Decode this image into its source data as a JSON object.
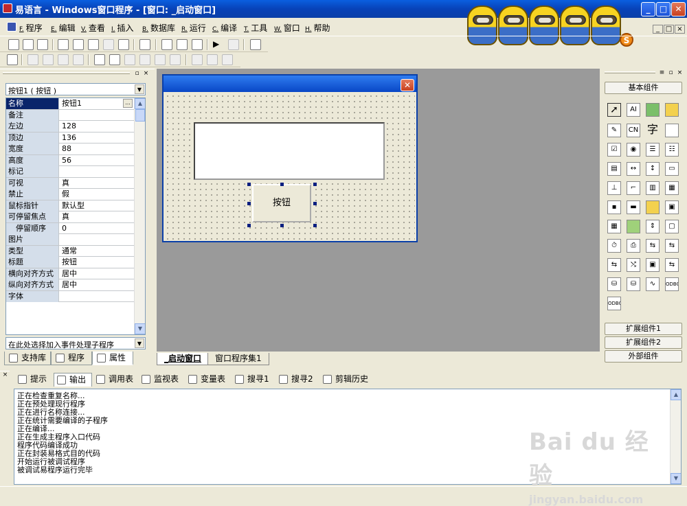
{
  "window": {
    "title": "易语言 - Windows窗口程序 - [窗口: _启动窗口]",
    "min_label": "_",
    "max_label": "□",
    "close_label": "✕"
  },
  "menu": [
    {
      "key": "F.",
      "label": "程序"
    },
    {
      "key": "E.",
      "label": "编辑"
    },
    {
      "key": "V.",
      "label": "查看"
    },
    {
      "key": "I.",
      "label": "插入"
    },
    {
      "key": "B.",
      "label": "数据库"
    },
    {
      "key": "R.",
      "label": "运行"
    },
    {
      "key": "C.",
      "label": "编译"
    },
    {
      "key": "T.",
      "label": "工具"
    },
    {
      "key": "W.",
      "label": "窗口"
    },
    {
      "key": "H.",
      "label": "帮助"
    }
  ],
  "mdi_controls": {
    "min": "_",
    "restore": "□",
    "close": "×"
  },
  "branding": {
    "coin": "S"
  },
  "property_panel": {
    "object_combo": "按钮1 ( 按钮 )",
    "properties": [
      {
        "name": "名称",
        "value": "按钮1"
      },
      {
        "name": "备注",
        "value": ""
      },
      {
        "name": "左边",
        "value": "128"
      },
      {
        "name": "顶边",
        "value": "136"
      },
      {
        "name": "宽度",
        "value": "88"
      },
      {
        "name": "高度",
        "value": "56"
      },
      {
        "name": "标记",
        "value": ""
      },
      {
        "name": "可视",
        "value": "真"
      },
      {
        "name": "禁止",
        "value": "假"
      },
      {
        "name": "鼠标指针",
        "value": "默认型"
      },
      {
        "name": "可停留焦点",
        "value": "真"
      },
      {
        "name": "停留顺序",
        "value": "0"
      },
      {
        "name": "图片",
        "value": ""
      },
      {
        "name": "类型",
        "value": "通常"
      },
      {
        "name": "标题",
        "value": "按钮"
      },
      {
        "name": "横向对齐方式",
        "value": "居中"
      },
      {
        "name": "纵向对齐方式",
        "value": "居中"
      },
      {
        "name": "字体",
        "value": ""
      }
    ],
    "ellipsis": "...",
    "event_combo": "在此处选择加入事件处理子程序",
    "tabs": [
      {
        "label": "支持库"
      },
      {
        "label": "程序"
      },
      {
        "label": "属性"
      }
    ]
  },
  "designer": {
    "button_caption": "按钮",
    "form_close": "✕"
  },
  "doc_tabs": [
    {
      "label": "_启动窗口"
    },
    {
      "label": "窗口程序集1"
    }
  ],
  "component_panel": {
    "basic_label": "基本组件",
    "ext1_label": "扩展组件1",
    "ext2_label": "扩展组件2",
    "external_label": "外部组件",
    "icons": [
      "arrow-pointer",
      "label-A",
      "picture",
      "shape",
      "edit-pen",
      "CN",
      "字",
      "line",
      "checkbox",
      "radio",
      "listbox",
      "grid",
      "table",
      "scroll-h",
      "scroll-v",
      "progress",
      "ruler",
      "bracket",
      "toolbar",
      "combo",
      "status",
      "file",
      "image",
      "globe",
      "spin",
      "timer",
      "printer",
      "net1",
      "window",
      "net2",
      "net3",
      "db1",
      "net4",
      "chart",
      "odbc",
      "odbc2",
      "odbc3"
    ],
    "icon_texts": {
      "CN": "CN",
      "字": "字",
      "odbc": "ODBC"
    }
  },
  "bottom_tabs": [
    {
      "label": "提示"
    },
    {
      "label": "输出"
    },
    {
      "label": "调用表"
    },
    {
      "label": "监视表"
    },
    {
      "label": "变量表"
    },
    {
      "label": "搜寻1"
    },
    {
      "label": "搜寻2"
    },
    {
      "label": "剪辑历史"
    }
  ],
  "output_lines": [
    "正在检查重复名称...",
    "正在预处理现行程序",
    "正在进行名称连接...",
    "正在统计需要编译的子程序",
    "正在编译...",
    "正在生成主程序入口代码",
    "程序代码编译成功",
    "正在封装易格式目的代码",
    "开始运行被调试程序",
    "被调试易程序运行完毕"
  ],
  "watermark": {
    "brand": "Bai du 经验",
    "url": "jingyan.baidu.com"
  },
  "colors": {
    "titlebar": "#0A5FE0",
    "selection": "#0A246A",
    "workspace": "#9a9a9a",
    "face": "#ECE9D8"
  }
}
